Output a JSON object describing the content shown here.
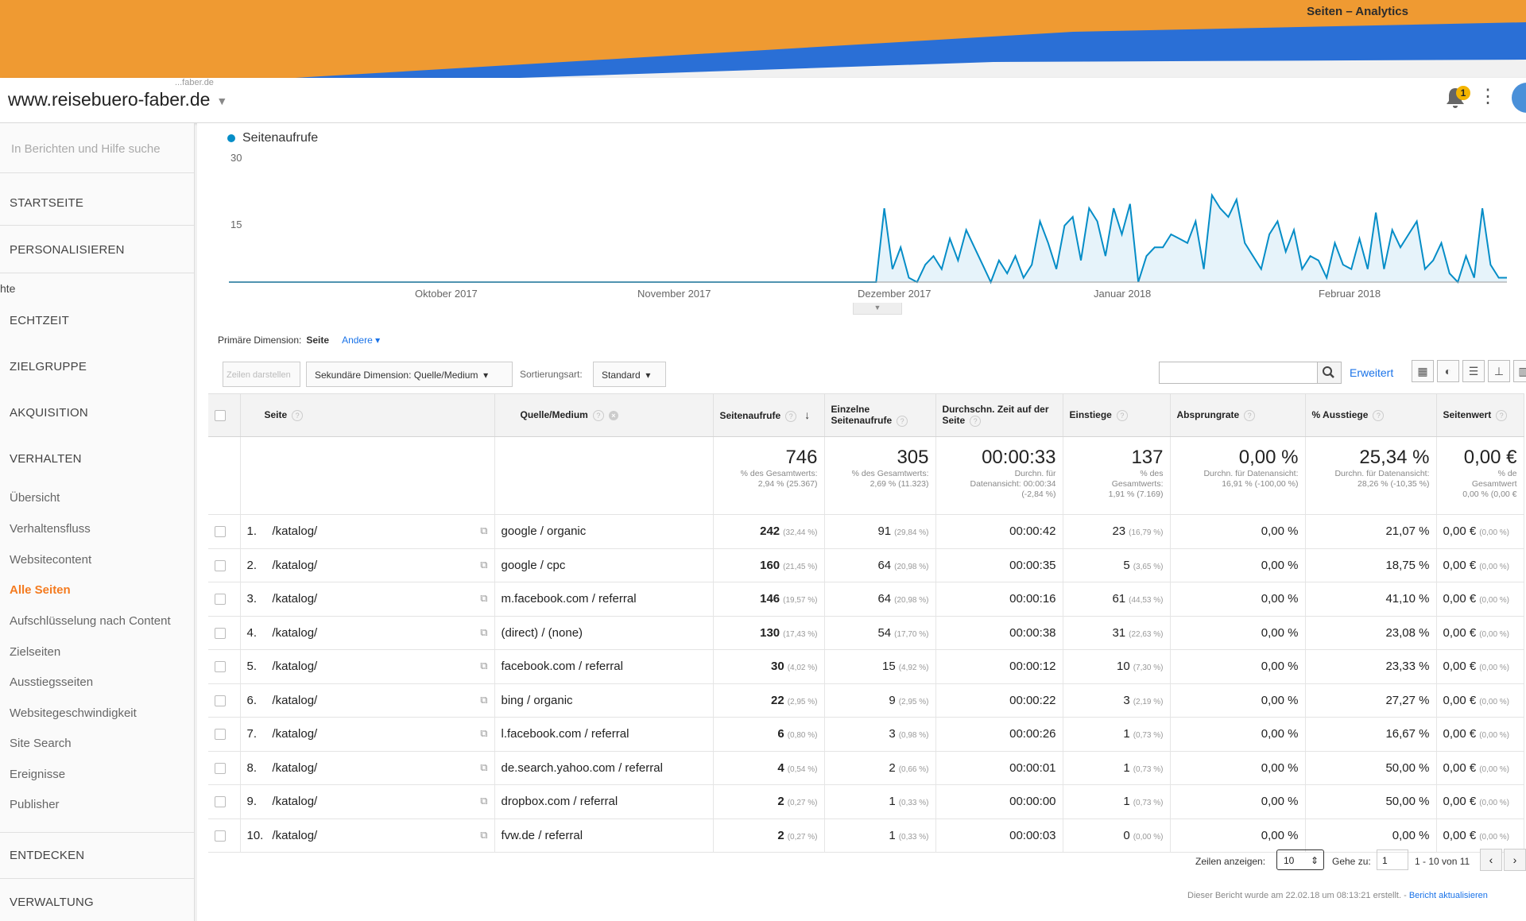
{
  "window": {
    "title": "Seiten – Analytics"
  },
  "colors": {
    "banner": "#ef9a32",
    "accent_blue": "#058dc7",
    "active_nav": "#f47b20"
  },
  "header": {
    "site_sub": "...faber.de",
    "site_name": "www.reisebuero-faber.de",
    "notification_count": "1"
  },
  "sidebar": {
    "search_placeholder": "In Berichten und Hilfe suche",
    "startseite": "STARTSEITE",
    "personalisieren": "PERSONALISIEREN",
    "section_fragment": "hte",
    "echtzeit": "ECHTZEIT",
    "zielgruppe": "ZIELGRUPPE",
    "akquisition": "AKQUISITION",
    "verhalten": "VERHALTEN",
    "sub": [
      "Übersicht",
      "Verhaltensfluss",
      "Websitecontent",
      "Alle Seiten",
      "Aufschlüsselung nach Content",
      "Zielseiten",
      "Ausstiegsseiten",
      "Websitegeschwindigkeit",
      "Site Search",
      "Ereignisse",
      "Publisher"
    ],
    "entdecken": "ENTDECKEN",
    "verwaltung": "VERWALTUNG"
  },
  "chart": {
    "legend": "Seitenaufrufe",
    "y_ticks": [
      "30",
      "15"
    ],
    "x_labels": [
      "Oktober 2017",
      "November 2017",
      "Dezember 2017",
      "Januar 2018",
      "Februar 2018"
    ]
  },
  "chart_data": {
    "type": "area",
    "series": [
      {
        "name": "Seitenaufrufe",
        "values": [
          0,
          0,
          0,
          0,
          0,
          0,
          0,
          0,
          0,
          0,
          0,
          0,
          0,
          0,
          0,
          0,
          0,
          0,
          0,
          0,
          0,
          0,
          0,
          0,
          0,
          0,
          0,
          0,
          0,
          0,
          0,
          0,
          0,
          0,
          0,
          0,
          0,
          0,
          0,
          0,
          0,
          0,
          0,
          0,
          0,
          0,
          0,
          0,
          0,
          0,
          0,
          0,
          0,
          0,
          0,
          0,
          0,
          0,
          0,
          0,
          0,
          0,
          0,
          0,
          0,
          0,
          0,
          0,
          0,
          0,
          0,
          0,
          0,
          0,
          0,
          0,
          0,
          0,
          0,
          0,
          17,
          3,
          8,
          1,
          0,
          4,
          6,
          3,
          10,
          5,
          12,
          8,
          4,
          0,
          5,
          2,
          6,
          1,
          4,
          14,
          9,
          3,
          13,
          15,
          5,
          17,
          14,
          6,
          17,
          11,
          18,
          0,
          6,
          8,
          8,
          11,
          10,
          9,
          14,
          3,
          20,
          17,
          15,
          19,
          9,
          6,
          3,
          11,
          14,
          7,
          12,
          3,
          6,
          5,
          1,
          9,
          4,
          3,
          10,
          3,
          16,
          3,
          12,
          8,
          11,
          14,
          3,
          5,
          9,
          2,
          0,
          6,
          1,
          17,
          4,
          1,
          1
        ],
        "start": "2017-09-12",
        "end": "2018-02-21",
        "interval": "day"
      }
    ],
    "ylim": [
      0,
      30
    ],
    "grid": false,
    "legend": "top-left"
  },
  "dimension": {
    "label": "Primäre Dimension:",
    "value": "Seite",
    "other": "Andere"
  },
  "toolbar": {
    "rows_btn": "Zeilen darstellen",
    "secondary_dim": "Sekundäre Dimension: Quelle/Medium",
    "sort_label": "Sortierungsart:",
    "sort_value": "Standard",
    "search_placeholder": "",
    "erweitert": "Erweitert"
  },
  "table": {
    "headers": {
      "seite": "Seite",
      "quelle": "Quelle/Medium",
      "views": "Seitenaufrufe",
      "unique": "Einzelne Seitenaufrufe",
      "avgtime": "Durchschn. Zeit auf der Seite",
      "entrances": "Einstiege",
      "bounce": "Absprungrate",
      "exit": "% Ausstiege",
      "value": "Seitenwert"
    },
    "totals": {
      "views": "746",
      "views_sub1": "% des Gesamtwerts:",
      "views_sub2": "2,94 % (25.367)",
      "unique": "305",
      "unique_sub1": "% des Gesamtwerts:",
      "unique_sub2": "2,69 % (11.323)",
      "avgtime": "00:00:33",
      "avgtime_sub1": "Durchn. für",
      "avgtime_sub2": "Datenansicht: 00:00:34",
      "avgtime_sub3": "(-2,84 %)",
      "entrances": "137",
      "entrances_sub1": "% des",
      "entrances_sub2": "Gesamtwerts:",
      "entrances_sub3": "1,91 % (7.169)",
      "bounce": "0,00 %",
      "bounce_sub1": "Durchn. für Datenansicht:",
      "bounce_sub2": "16,91 % (-100,00 %)",
      "exit": "25,34 %",
      "exit_sub1": "Durchn. für Datenansicht:",
      "exit_sub2": "28,26 % (-10,35 %)",
      "value": "0,00 €",
      "value_sub1": "% de",
      "value_sub2": "Gesamtwert",
      "value_sub3": "0,00 % (0,00 €"
    },
    "rows": [
      {
        "idx": "1.",
        "page": "/katalog/",
        "source": "google / organic",
        "views": "242",
        "views_pct": "(32,44 %)",
        "unique": "91",
        "unique_pct": "(29,84 %)",
        "time": "00:00:42",
        "ent": "23",
        "ent_pct": "(16,79 %)",
        "bounce": "0,00 %",
        "exit": "21,07 %",
        "value": "0,00 €",
        "value_pct": "(0,00 %)"
      },
      {
        "idx": "2.",
        "page": "/katalog/",
        "source": "google / cpc",
        "views": "160",
        "views_pct": "(21,45 %)",
        "unique": "64",
        "unique_pct": "(20,98 %)",
        "time": "00:00:35",
        "ent": "5",
        "ent_pct": "(3,65 %)",
        "bounce": "0,00 %",
        "exit": "18,75 %",
        "value": "0,00 €",
        "value_pct": "(0,00 %)"
      },
      {
        "idx": "3.",
        "page": "/katalog/",
        "source": "m.facebook.com / referral",
        "views": "146",
        "views_pct": "(19,57 %)",
        "unique": "64",
        "unique_pct": "(20,98 %)",
        "time": "00:00:16",
        "ent": "61",
        "ent_pct": "(44,53 %)",
        "bounce": "0,00 %",
        "exit": "41,10 %",
        "value": "0,00 €",
        "value_pct": "(0,00 %)"
      },
      {
        "idx": "4.",
        "page": "/katalog/",
        "source": "(direct) / (none)",
        "views": "130",
        "views_pct": "(17,43 %)",
        "unique": "54",
        "unique_pct": "(17,70 %)",
        "time": "00:00:38",
        "ent": "31",
        "ent_pct": "(22,63 %)",
        "bounce": "0,00 %",
        "exit": "23,08 %",
        "value": "0,00 €",
        "value_pct": "(0,00 %)"
      },
      {
        "idx": "5.",
        "page": "/katalog/",
        "source": "facebook.com / referral",
        "views": "30",
        "views_pct": "(4,02 %)",
        "unique": "15",
        "unique_pct": "(4,92 %)",
        "time": "00:00:12",
        "ent": "10",
        "ent_pct": "(7,30 %)",
        "bounce": "0,00 %",
        "exit": "23,33 %",
        "value": "0,00 €",
        "value_pct": "(0,00 %)"
      },
      {
        "idx": "6.",
        "page": "/katalog/",
        "source": "bing / organic",
        "views": "22",
        "views_pct": "(2,95 %)",
        "unique": "9",
        "unique_pct": "(2,95 %)",
        "time": "00:00:22",
        "ent": "3",
        "ent_pct": "(2,19 %)",
        "bounce": "0,00 %",
        "exit": "27,27 %",
        "value": "0,00 €",
        "value_pct": "(0,00 %)"
      },
      {
        "idx": "7.",
        "page": "/katalog/",
        "source": "l.facebook.com / referral",
        "views": "6",
        "views_pct": "(0,80 %)",
        "unique": "3",
        "unique_pct": "(0,98 %)",
        "time": "00:00:26",
        "ent": "1",
        "ent_pct": "(0,73 %)",
        "bounce": "0,00 %",
        "exit": "16,67 %",
        "value": "0,00 €",
        "value_pct": "(0,00 %)"
      },
      {
        "idx": "8.",
        "page": "/katalog/",
        "source": "de.search.yahoo.com / referral",
        "views": "4",
        "views_pct": "(0,54 %)",
        "unique": "2",
        "unique_pct": "(0,66 %)",
        "time": "00:00:01",
        "ent": "1",
        "ent_pct": "(0,73 %)",
        "bounce": "0,00 %",
        "exit": "50,00 %",
        "value": "0,00 €",
        "value_pct": "(0,00 %)"
      },
      {
        "idx": "9.",
        "page": "/katalog/",
        "source": "dropbox.com / referral",
        "views": "2",
        "views_pct": "(0,27 %)",
        "unique": "1",
        "unique_pct": "(0,33 %)",
        "time": "00:00:00",
        "ent": "1",
        "ent_pct": "(0,73 %)",
        "bounce": "0,00 %",
        "exit": "50,00 %",
        "value": "0,00 €",
        "value_pct": "(0,00 %)"
      },
      {
        "idx": "10.",
        "page": "/katalog/",
        "source": "fvw.de / referral",
        "views": "2",
        "views_pct": "(0,27 %)",
        "unique": "1",
        "unique_pct": "(0,33 %)",
        "time": "00:00:03",
        "ent": "0",
        "ent_pct": "(0,00 %)",
        "bounce": "0,00 %",
        "exit": "0,00 %",
        "value": "0,00 €",
        "value_pct": "(0,00 %)"
      }
    ]
  },
  "footer": {
    "rows_label": "Zeilen anzeigen:",
    "rows_value": "10",
    "goto_label": "Gehe zu:",
    "goto_value": "1",
    "range": "1 - 10 von 11",
    "created": "Dieser Bericht wurde am 22.02.18 um 08:13:21 erstellt. -",
    "refresh": "Bericht aktualisieren"
  }
}
